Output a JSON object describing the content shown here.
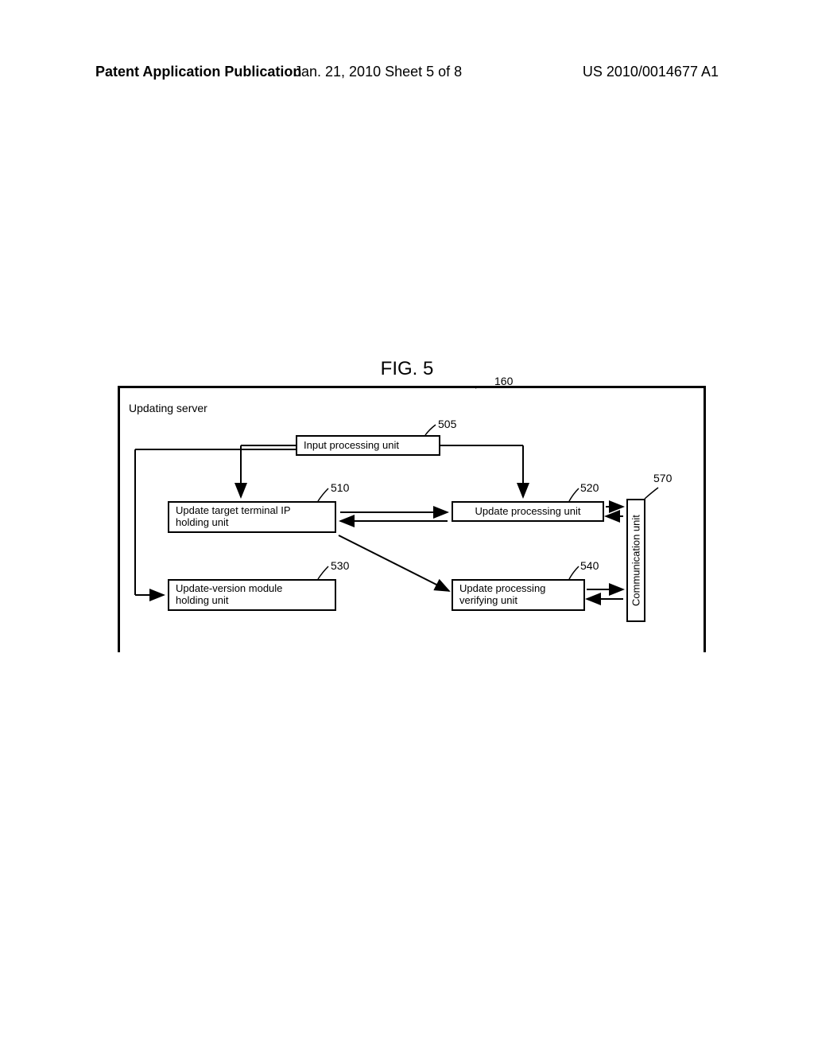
{
  "header": {
    "left": "Patent Application Publication",
    "center": "Jan. 21, 2010  Sheet 5 of 8",
    "right": "US 2010/0014677 A1"
  },
  "figure": {
    "title": "FIG. 5",
    "server_label": "Updating server",
    "ref_main": "160",
    "units": {
      "input": {
        "label": "Input processing unit",
        "ref": "505"
      },
      "ip_holding": {
        "label": "Update target terminal IP\nholding unit",
        "ref": "510"
      },
      "update_proc": {
        "label": "Update processing unit",
        "ref": "520"
      },
      "version_module": {
        "label": "Update-version module\nholding unit",
        "ref": "530"
      },
      "verify": {
        "label": "Update processing\nverifying unit",
        "ref": "540"
      },
      "comm": {
        "label": "Communication unit",
        "ref": "570"
      }
    }
  }
}
